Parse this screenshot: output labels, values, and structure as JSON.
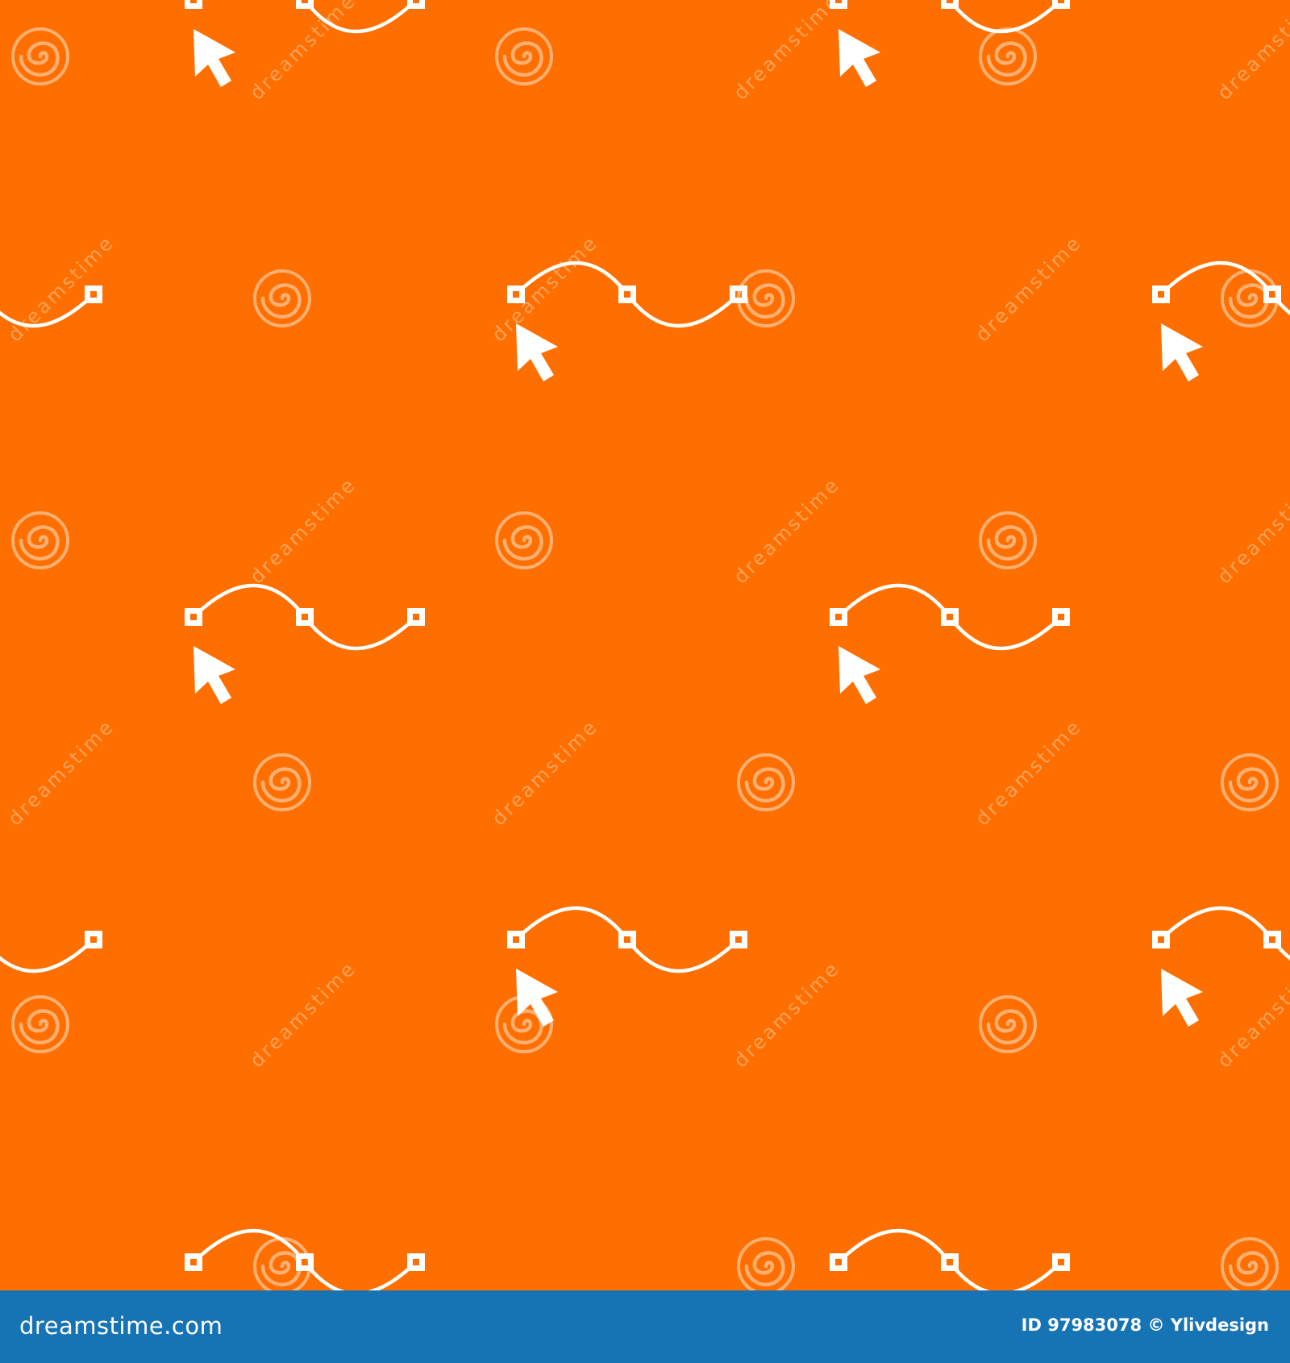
{
  "colors": {
    "background": "#ff6f00",
    "icon": "#ffffff",
    "footer": "#1673b4",
    "watermark": "#ffffff"
  },
  "watermark": {
    "text": "dreamstime",
    "logo_icon": "dreamstime-spiral-logo-icon"
  },
  "pattern": {
    "icon": "bezier-curve-cursor-icon",
    "tile_count": 20
  },
  "footer": {
    "brand": "dreamstime.com",
    "id_label": "ID",
    "id_value": "97983078",
    "copyright_symbol": "©",
    "author": "Ylivdesign"
  }
}
